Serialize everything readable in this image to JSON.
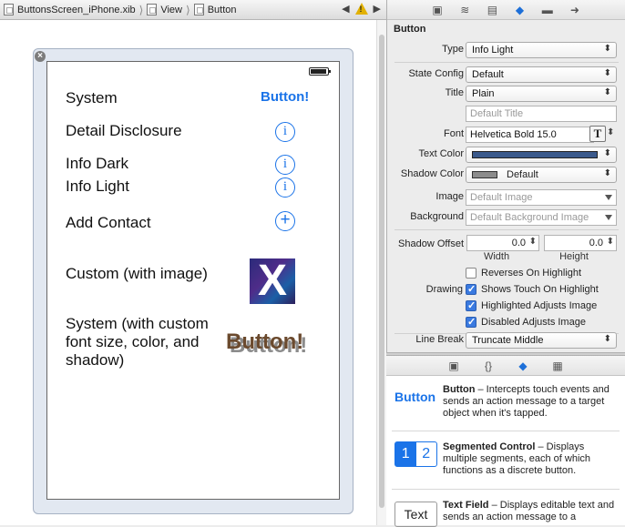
{
  "jumpbar": {
    "file": "ButtonsScreen_iPhone.xib",
    "view": "View",
    "button": "Button",
    "sep": "⟩",
    "nav_left": "◀",
    "nav_right": "▶",
    "warning": "!"
  },
  "canvas": {
    "close": "×",
    "rows": {
      "system": "System",
      "detail": "Detail Disclosure",
      "info_dark": "Info Dark",
      "info_light": "Info Light",
      "add_contact": "Add Contact",
      "custom": "Custom (with image)",
      "system_custom": "System (with custom font size, color, and shadow)"
    },
    "button_label": "Button!",
    "info_glyph": "i",
    "add_glyph": "+",
    "x_glyph": "X",
    "big_button_label": "Button!"
  },
  "inspector": {
    "tabs": [
      "▣",
      "≋",
      "▤",
      "◆",
      "▬",
      "➜"
    ],
    "section": "Button",
    "type_label": "Type",
    "type_value": "Info Light",
    "state_label": "State Config",
    "state_value": "Default",
    "title_label": "Title",
    "title_value": "Plain",
    "title_placeholder": "Default Title",
    "font_label": "Font",
    "font_value": "Helvetica Bold 15.0",
    "font_btn": "T",
    "stepper": "⬍",
    "text_color_label": "Text Color",
    "text_color": "#3b5a8c",
    "shadow_color_label": "Shadow Color",
    "shadow_color": "#8c8c8c",
    "shadow_color_value": "Default",
    "image_label": "Image",
    "image_placeholder": "Default Image",
    "background_label": "Background",
    "background_placeholder": "Default Background Image",
    "shadow_offset_label": "Shadow Offset",
    "shadow_width": "0.0",
    "shadow_height": "0.0",
    "width_label": "Width",
    "height_label": "Height",
    "drawing_label": "Drawing",
    "checks": [
      {
        "label": "Reverses On Highlight",
        "checked": false
      },
      {
        "label": "Shows Touch On Highlight",
        "checked": true
      },
      {
        "label": "Highlighted Adjusts Image",
        "checked": true
      },
      {
        "label": "Disabled Adjusts Image",
        "checked": true
      }
    ],
    "line_break_label": "Line Break",
    "line_break_value": "Truncate Middle"
  },
  "library": {
    "tabs": [
      "▣",
      "{}",
      "◆",
      "▦"
    ],
    "items": [
      {
        "icon": "Button",
        "title": "Button",
        "desc": " – Intercepts touch events and sends an action message to a target object when it's tapped."
      },
      {
        "icon": "1 2",
        "title": "Segmented Control",
        "desc": " – Displays multiple segments, each of which functions as a discrete button."
      },
      {
        "icon": "Text",
        "title": "Text Field",
        "desc": " – Displays editable text and sends an action message to a"
      }
    ],
    "seg1": "1",
    "seg2": "2"
  },
  "colors": {
    "accent": "#1a73e8",
    "custom_button_text": "#6b4a2e"
  }
}
